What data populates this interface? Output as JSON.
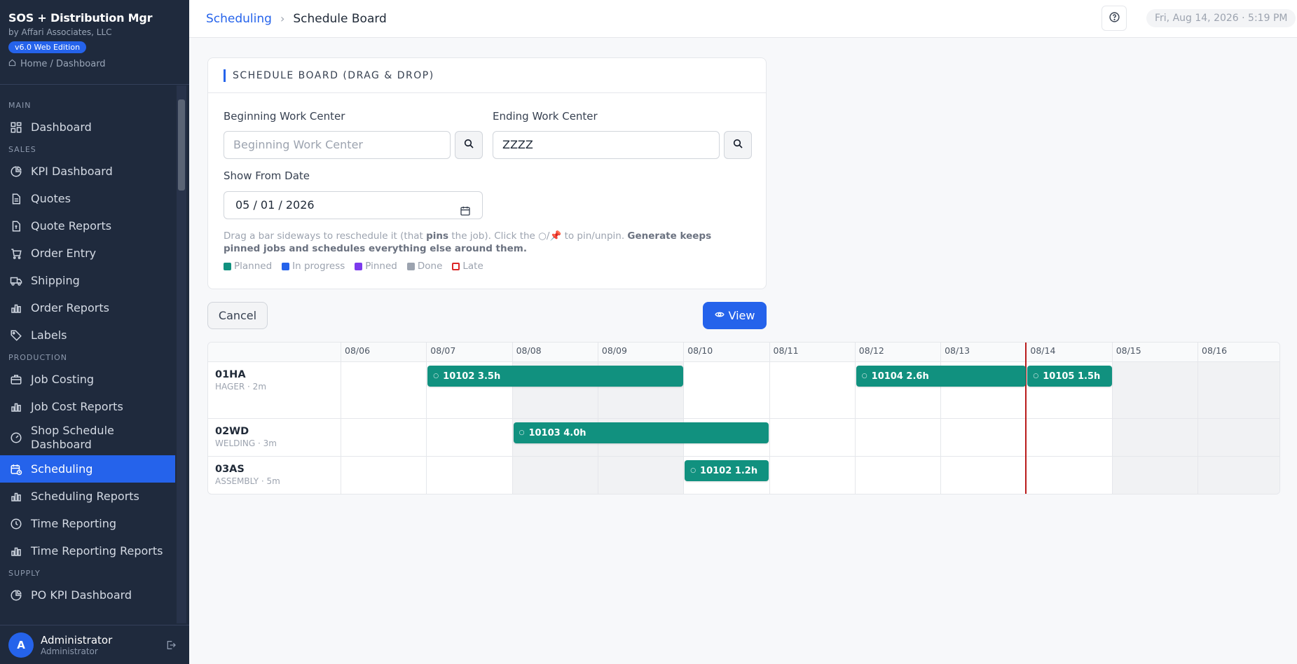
{
  "app": {
    "title": "SOS + Distribution Mgr",
    "company": "by Affari Associates, LLC",
    "edition": "v6.0 Web Edition",
    "home_link": "Home / Dashboard"
  },
  "sidebar": {
    "sections": {
      "main": "MAIN",
      "sales": "SALES",
      "production": "PRODUCTION",
      "supply": "SUPPLY"
    },
    "items": {
      "dashboard": "Dashboard",
      "kpi_dashboard": "KPI Dashboard",
      "quotes": "Quotes",
      "quote_reports": "Quote Reports",
      "order_entry": "Order Entry",
      "shipping": "Shipping",
      "order_reports": "Order Reports",
      "labels": "Labels",
      "job_costing": "Job Costing",
      "job_cost_reports": "Job Cost Reports",
      "shop_schedule_dashboard_1": "Shop Schedule",
      "shop_schedule_dashboard_2": "Dashboard",
      "scheduling": "Scheduling",
      "scheduling_reports": "Scheduling Reports",
      "time_reporting": "Time Reporting",
      "time_reporting_reports": "Time Reporting Reports",
      "po_kpi_dashboard": "PO KPI Dashboard"
    },
    "active": "Scheduling",
    "user": {
      "initial": "A",
      "name": "Administrator",
      "role": "Administrator"
    }
  },
  "topbar": {
    "breadcrumb_parent": "Scheduling",
    "breadcrumb_separator": "›",
    "breadcrumb_current": "Schedule Board",
    "datetime": "Fri, Aug 14, 2026 · 5:19 PM"
  },
  "form": {
    "title": "SCHEDULE BOARD (DRAG & DROP)",
    "beginning_label": "Beginning Work Center",
    "beginning_placeholder": "Beginning Work Center",
    "beginning_value": "",
    "ending_label": "Ending Work Center",
    "ending_value": "ZZZZ",
    "show_from_label": "Show From Date",
    "show_from_value": "05 / 01 / 2026",
    "help_1": "Drag a bar sideways to reschedule it (that ",
    "help_pins": "pins",
    "help_2": " the job). Click the ○/📌 to pin/unpin. ",
    "help_bold": "Generate keeps pinned jobs and schedules everything else around them.",
    "legend": [
      {
        "label": "Planned",
        "color": "#11917f"
      },
      {
        "label": "In progress",
        "color": "#2563eb"
      },
      {
        "label": "Pinned",
        "color": "#7c3aed"
      },
      {
        "label": "Done",
        "color": "#9ca3af"
      },
      {
        "label": "Late",
        "color": "#dc2626"
      }
    ],
    "cancel_label": "Cancel",
    "view_label": "View"
  },
  "gantt": {
    "days": [
      "08/06",
      "08/07",
      "08/08",
      "08/09",
      "08/10",
      "08/11",
      "08/12",
      "08/13",
      "08/14",
      "08/15",
      "08/16"
    ],
    "weekend_days": [
      "08/08",
      "08/09",
      "08/15",
      "08/16"
    ],
    "today": "08/14",
    "rows": [
      {
        "wc": "01HA",
        "meta": "HAGER · 2m"
      },
      {
        "wc": "02WD",
        "meta": "WELDING · 3m"
      },
      {
        "wc": "03AS",
        "meta": "ASSEMBLY · 5m"
      }
    ],
    "jobs": [
      {
        "label": "10102 3.5h",
        "row": "01HA",
        "start": "08/07",
        "end": "08/10",
        "pin": "○"
      },
      {
        "label": "10104 2.6h",
        "row": "01HA",
        "start": "08/12",
        "end": "08/14",
        "pin": "○"
      },
      {
        "label": "10105 1.5h",
        "row": "01HA",
        "start": "08/14",
        "end": "08/15",
        "pin": "○"
      },
      {
        "label": "10103 4.0h",
        "row": "02WD",
        "start": "08/08",
        "end": "08/11",
        "pin": "○"
      },
      {
        "label": "10102 1.2h",
        "row": "03AS",
        "start": "08/10",
        "end": "08/11",
        "pin": "○"
      }
    ]
  }
}
